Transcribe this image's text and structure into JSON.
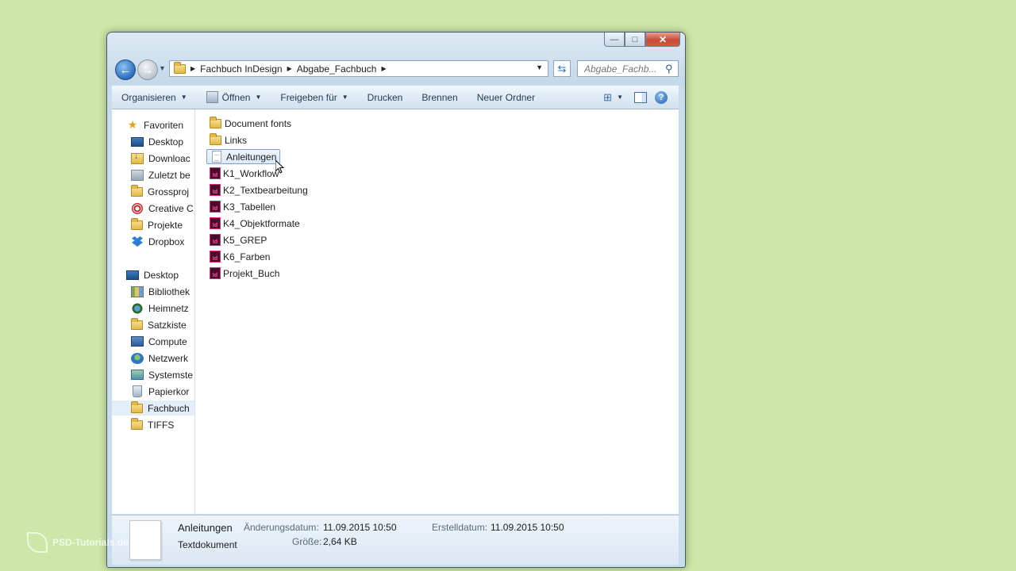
{
  "window": {
    "caption_min": "—",
    "caption_max": "□",
    "caption_close": "✕"
  },
  "address_bar": {
    "crumbs": [
      "Fachbuch InDesign",
      "Abgabe_Fachbuch"
    ]
  },
  "search": {
    "placeholder": "Abgabe_Fachb..."
  },
  "toolbar": {
    "organize": "Organisieren",
    "open": "Öffnen",
    "share": "Freigeben für",
    "print": "Drucken",
    "burn": "Brennen",
    "new_folder": "Neuer Ordner",
    "help": "?"
  },
  "nav": {
    "favorites_label": "Favoriten",
    "favorites": [
      {
        "label": "Desktop",
        "icon": "desktop-icon"
      },
      {
        "label": "Downloac",
        "icon": "downloads-icon"
      },
      {
        "label": "Zuletzt be",
        "icon": "recent-places-icon"
      },
      {
        "label": "Grossproj",
        "icon": "folder-icon"
      },
      {
        "label": "Creative C",
        "icon": "creative-cloud-icon"
      },
      {
        "label": "Projekte",
        "icon": "folder-icon"
      },
      {
        "label": "Dropbox",
        "icon": "dropbox-icon"
      }
    ],
    "desktop_label": "Desktop",
    "desktop_items": [
      {
        "label": "Bibliothek",
        "icon": "libraries-icon"
      },
      {
        "label": "Heimnetz",
        "icon": "homegroup-icon"
      },
      {
        "label": "Satzkiste",
        "icon": "folder-icon"
      },
      {
        "label": "Compute",
        "icon": "computer-icon"
      },
      {
        "label": "Netzwerk",
        "icon": "network-icon"
      },
      {
        "label": "Systemste",
        "icon": "control-panel-icon"
      },
      {
        "label": "Papierkor",
        "icon": "recycle-bin-icon"
      },
      {
        "label": "Fachbuch",
        "icon": "folder-icon"
      },
      {
        "label": "TIFFS",
        "icon": "folder-icon"
      }
    ],
    "selected": "Fachbuch"
  },
  "files": [
    {
      "name": "Document fonts",
      "type": "folder"
    },
    {
      "name": "Links",
      "type": "folder"
    },
    {
      "name": "Anleitungen",
      "type": "text"
    },
    {
      "name": "K1_Workflow",
      "type": "indd"
    },
    {
      "name": "K2_Textbearbeitung",
      "type": "indd"
    },
    {
      "name": "K3_Tabellen",
      "type": "indd"
    },
    {
      "name": "K4_Objektformate",
      "type": "indd"
    },
    {
      "name": "K5_GREP",
      "type": "indd"
    },
    {
      "name": "K6_Farben",
      "type": "indd"
    },
    {
      "name": "Projekt_Buch",
      "type": "indd"
    }
  ],
  "selected_file": "Anleitungen",
  "indd_glyph": "Id",
  "details": {
    "name": "Anleitungen",
    "type": "Textdokument",
    "modified_label": "Änderungsdatum:",
    "modified_value": "11.09.2015 10:50",
    "size_label": "Größe:",
    "size_value": "2,64 KB",
    "created_label": "Erstelldatum:",
    "created_value": "11.09.2015 10:50"
  },
  "watermark": "PSD-Tutorials.de",
  "colors": {
    "desktop_bg": "#cde7a8",
    "window_frame": "#c9dcea",
    "selection": "#dbeaf9"
  }
}
